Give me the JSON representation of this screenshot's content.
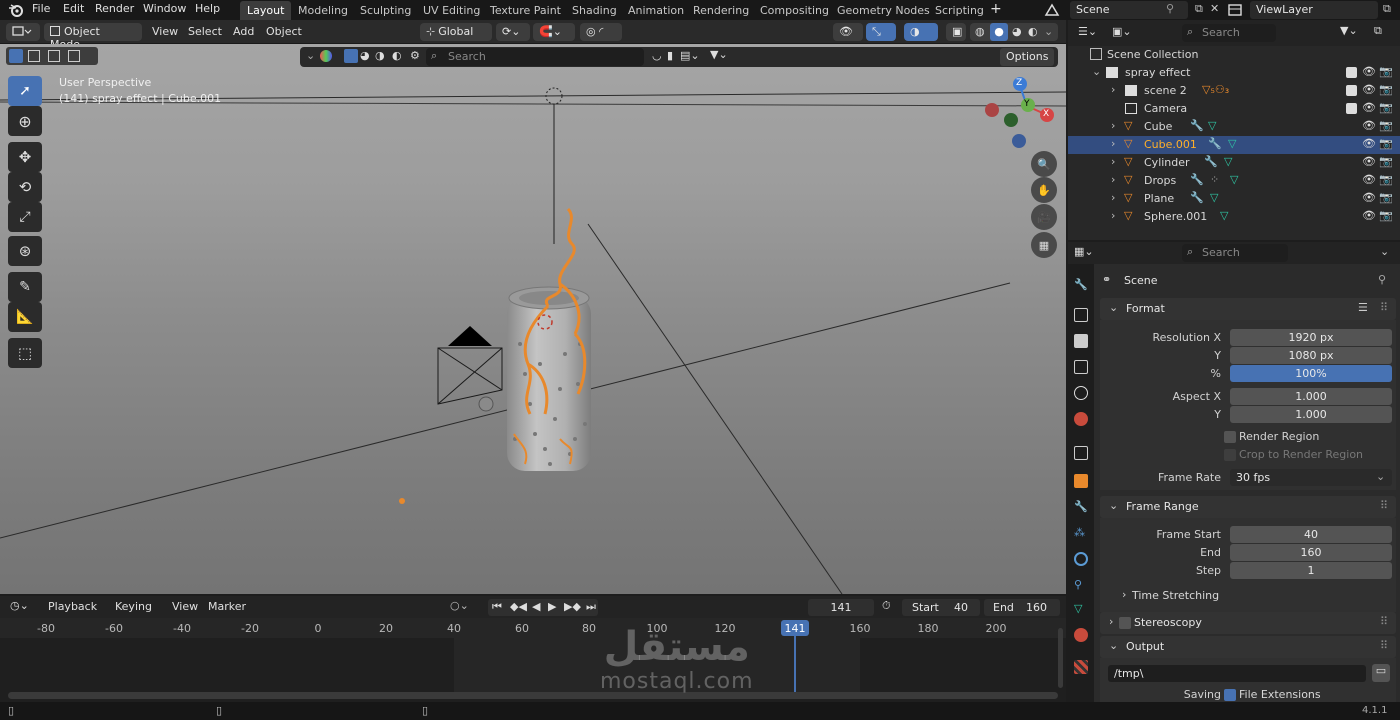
{
  "menubar": {
    "items": [
      "File",
      "Edit",
      "Render",
      "Window",
      "Help"
    ],
    "workspaces": [
      "Layout",
      "Modeling",
      "Sculpting",
      "UV Editing",
      "Texture Paint",
      "Shading",
      "Animation",
      "Rendering",
      "Compositing",
      "Geometry Nodes",
      "Scripting"
    ],
    "active_workspace": "Layout",
    "add_tab": "+",
    "scene_name": "Scene",
    "view_layer": "ViewLayer"
  },
  "viewport_header": {
    "mode": "Object Mode",
    "menus": [
      "View",
      "Select",
      "Add",
      "Object"
    ],
    "transform_orientation": "Global",
    "search_placeholder": "Search",
    "options_label": "Options"
  },
  "viewport": {
    "perspective_label": "User Perspective",
    "object_info": "(141) spray effect | Cube.001",
    "gizmo_axes": [
      "Z",
      "Y",
      "X"
    ]
  },
  "timeline": {
    "menus": [
      "Playback",
      "Keying",
      "View",
      "Marker"
    ],
    "current_frame": "141",
    "start_label": "Start",
    "start_value": "40",
    "end_label": "End",
    "end_value": "160",
    "ruler": [
      "-80",
      "-60",
      "-40",
      "-20",
      "0",
      "20",
      "40",
      "60",
      "80",
      "100",
      "120",
      "141",
      "160",
      "180",
      "200"
    ]
  },
  "outliner": {
    "search_placeholder": "Search",
    "collection_root": "Scene Collection",
    "collection": "spray effect",
    "items": [
      {
        "name": "scene 2",
        "selected": false
      },
      {
        "name": "Camera",
        "selected": false
      },
      {
        "name": "Cube",
        "selected": false
      },
      {
        "name": "Cube.001",
        "selected": true
      },
      {
        "name": "Cylinder",
        "selected": false
      },
      {
        "name": "Drops",
        "selected": false
      },
      {
        "name": "Plane",
        "selected": false
      },
      {
        "name": "Sphere.001",
        "selected": false
      }
    ]
  },
  "properties": {
    "search_placeholder": "Search",
    "context": "Scene",
    "format": {
      "title": "Format",
      "resolution_x_label": "Resolution X",
      "resolution_x": "1920 px",
      "resolution_y_label": "Y",
      "resolution_y": "1080 px",
      "percent_label": "%",
      "percent": "100%",
      "aspect_x_label": "Aspect X",
      "aspect_x": "1.000",
      "aspect_y_label": "Y",
      "aspect_y": "1.000",
      "render_region": "Render Region",
      "crop_region": "Crop to Render Region",
      "frame_rate_label": "Frame Rate",
      "frame_rate": "30 fps"
    },
    "frame_range": {
      "title": "Frame Range",
      "start_label": "Frame Start",
      "start": "40",
      "end_label": "End",
      "end": "160",
      "step_label": "Step",
      "step": "1",
      "time_stretching": "Time Stretching"
    },
    "stereoscopy": "Stereoscopy",
    "output": {
      "title": "Output",
      "path": "/tmp\\",
      "saving_label": "Saving",
      "file_extensions": "File Extensions"
    }
  },
  "statusbar": {
    "version": "4.1.1"
  },
  "watermark": {
    "arabic": "مستقل",
    "latin": "mostaql.com"
  }
}
